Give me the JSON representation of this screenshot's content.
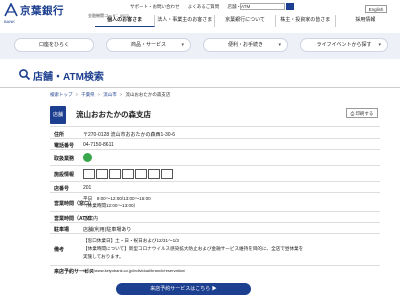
{
  "header": {
    "logo_text": "京葉銀行",
    "logo_sub": "BANK",
    "bank_code": "金融機関コード：0522",
    "util_links": [
      "サポート・お問い合わせ",
      "よくあるご質問",
      "店舗・ATM"
    ],
    "search_placeholder": "",
    "english_label": "English",
    "gnav": [
      "個人のお客さま",
      "法人・事業主のお客さま",
      "京葉銀行について",
      "株主・投資家の皆さま",
      "採用情報"
    ]
  },
  "subnav": {
    "items": [
      "口座をひらく",
      "商品・サービス",
      "便利・お手続き",
      "ライフイベントから探す"
    ]
  },
  "page": {
    "title": "店舗・ATM検索"
  },
  "breadcrumb": {
    "items": [
      "検索トップ",
      "千葉県",
      "流山市"
    ],
    "current": "流山おおたかの森支店"
  },
  "branch": {
    "badge": "店舗",
    "name": "流山おおたかの森支店",
    "print_label": "印刷する"
  },
  "info": {
    "address_label": "住所",
    "address_value": "〒270-0128 流山市おおたかの森西1-30-6",
    "phone_label": "電話番号",
    "phone_value": "04-7150-8611",
    "handling_label": "取扱業務",
    "facility_label": "施設情報",
    "store_no_label": "店番号",
    "store_no_value": "201",
    "hours_window_label": "営業時間（窓口）",
    "hours_window_line1": "平日　9:00～12:00/13:00～15:00",
    "hours_window_line2": "（休業時間12:00～13:00）",
    "hours_atm_label": "営業時間（ATM）",
    "hours_atm_value": "ご案内",
    "parking_label": "駐車場",
    "parking_value": "店舗(利用)駐車場あり",
    "notes_label": "備考",
    "notes_line1": "【窓口休業日】土・日・祝日および12/31～1/3",
    "notes_line2": "【休業時間について】新型コロナウイルス感染拡大防止および金融サービス維持を目的に、全店で昼休業を",
    "notes_line3": "実施しております。",
    "reservation_label": "来店予約サービス",
    "reservation_value": "https://www.keiyobank.co.jp/individual/branch/reservation/"
  },
  "cta": {
    "label": "来店予約サービスはこちら ▶"
  },
  "colors": {
    "brand": "#1c3f8f",
    "subnav_bg": "#eef0f7",
    "green": "#3aa64b"
  }
}
